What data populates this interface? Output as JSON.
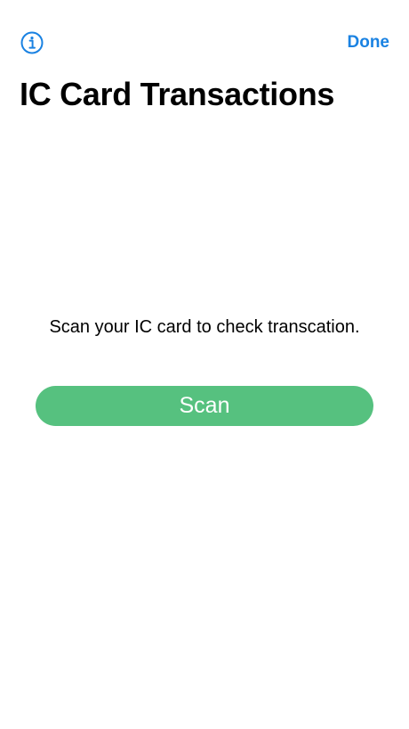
{
  "nav": {
    "info_icon": "info-circle-icon",
    "done_label": "Done"
  },
  "page": {
    "title": "IC Card Transactions"
  },
  "main": {
    "instruction": "Scan your IC card to check transcation.",
    "scan_label": "Scan"
  },
  "colors": {
    "accent": "#1a82e2",
    "scan_button": "#56c17f",
    "background": "#ffffff",
    "text": "#000000"
  }
}
